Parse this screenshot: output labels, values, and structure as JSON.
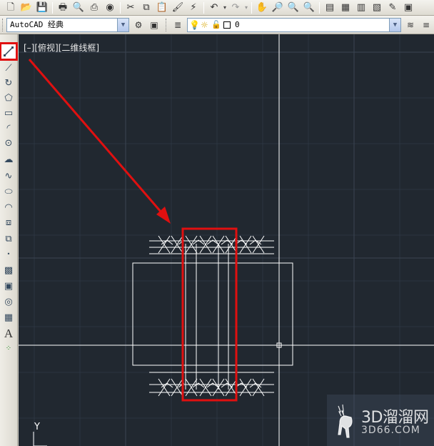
{
  "toolbar": {
    "icons": [
      "new-file-icon",
      "open-file-icon",
      "save-icon",
      "plot-icon",
      "plot-preview-icon",
      "publish-icon",
      "3d-dwf-icon",
      "cut-icon",
      "copy-icon",
      "paste-icon",
      "match-properties-icon",
      "block-editor-icon",
      "undo-icon",
      "redo-icon",
      "pan-icon",
      "zoom-realtime-icon",
      "zoom-window-icon",
      "zoom-previous-icon",
      "properties-icon",
      "design-center-icon",
      "tool-palettes-icon",
      "sheet-set-icon",
      "markup-icon",
      "quickcalc-icon"
    ]
  },
  "workspace": {
    "selected": "AutoCAD 经典"
  },
  "layer": {
    "selected": "0",
    "state_icons": [
      "light-bulb-icon",
      "sun-icon",
      "unlock-icon",
      "color-square-icon"
    ]
  },
  "draw_tools": {
    "items": [
      "line",
      "construction-line",
      "polyline",
      "polygon",
      "rectangle",
      "arc",
      "circle",
      "revision-cloud",
      "spline",
      "ellipse",
      "ellipse-arc",
      "insert-block",
      "make-block",
      "point",
      "hatch",
      "gradient",
      "region",
      "table",
      "multiline-text",
      "add-selected"
    ]
  },
  "viewport": {
    "label": "[–][俯视][二维线框]",
    "ucs_y_label": "Y"
  },
  "annotation": {
    "highlight_color": "#e01010"
  },
  "watermark": {
    "brand": "3D溜溜网",
    "url": "3D66.COM"
  },
  "colors": {
    "canvas_bg": "#212830",
    "grid": "#2c3541",
    "geometry": "#ffffff"
  }
}
